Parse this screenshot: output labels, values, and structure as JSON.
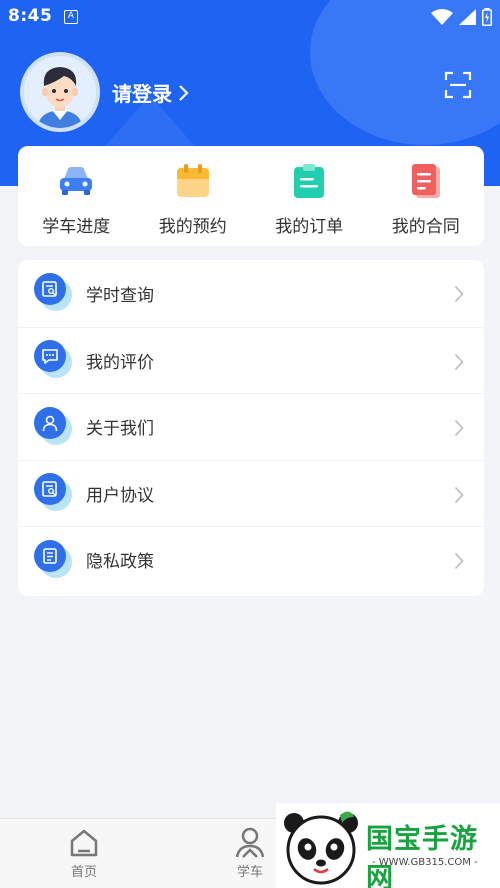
{
  "status_bar": {
    "time": "8:45",
    "notification_icon": "A"
  },
  "header": {
    "login_label": "请登录",
    "avatar_icon": "avatar-boy",
    "scan_icon": "scan-icon",
    "colors": {
      "primary": "#1f63f2",
      "accent": "#4d89f7"
    }
  },
  "quick_actions": [
    {
      "label": "学车进度",
      "icon": "car-icon",
      "color": "#3d7ef6"
    },
    {
      "label": "我的预约",
      "icon": "calendar-icon",
      "color": "#f9b836"
    },
    {
      "label": "我的订单",
      "icon": "clipboard-icon",
      "color": "#21cfae"
    },
    {
      "label": "我的合同",
      "icon": "document-icon",
      "color": "#f0605e"
    }
  ],
  "menu": [
    {
      "label": "学时查询",
      "icon": "search-doc-icon"
    },
    {
      "label": "我的评价",
      "icon": "chat-icon"
    },
    {
      "label": "关于我们",
      "icon": "user-icon"
    },
    {
      "label": "用户协议",
      "icon": "search-doc-icon"
    },
    {
      "label": "隐私政策",
      "icon": "document-icon"
    }
  ],
  "tabs": [
    {
      "label": "首页",
      "icon": "home-icon"
    },
    {
      "label": "学车",
      "icon": "learner-icon"
    }
  ],
  "watermark": {
    "title": "国宝手游网",
    "subtitle": "- WWW.GB315.COM -"
  }
}
